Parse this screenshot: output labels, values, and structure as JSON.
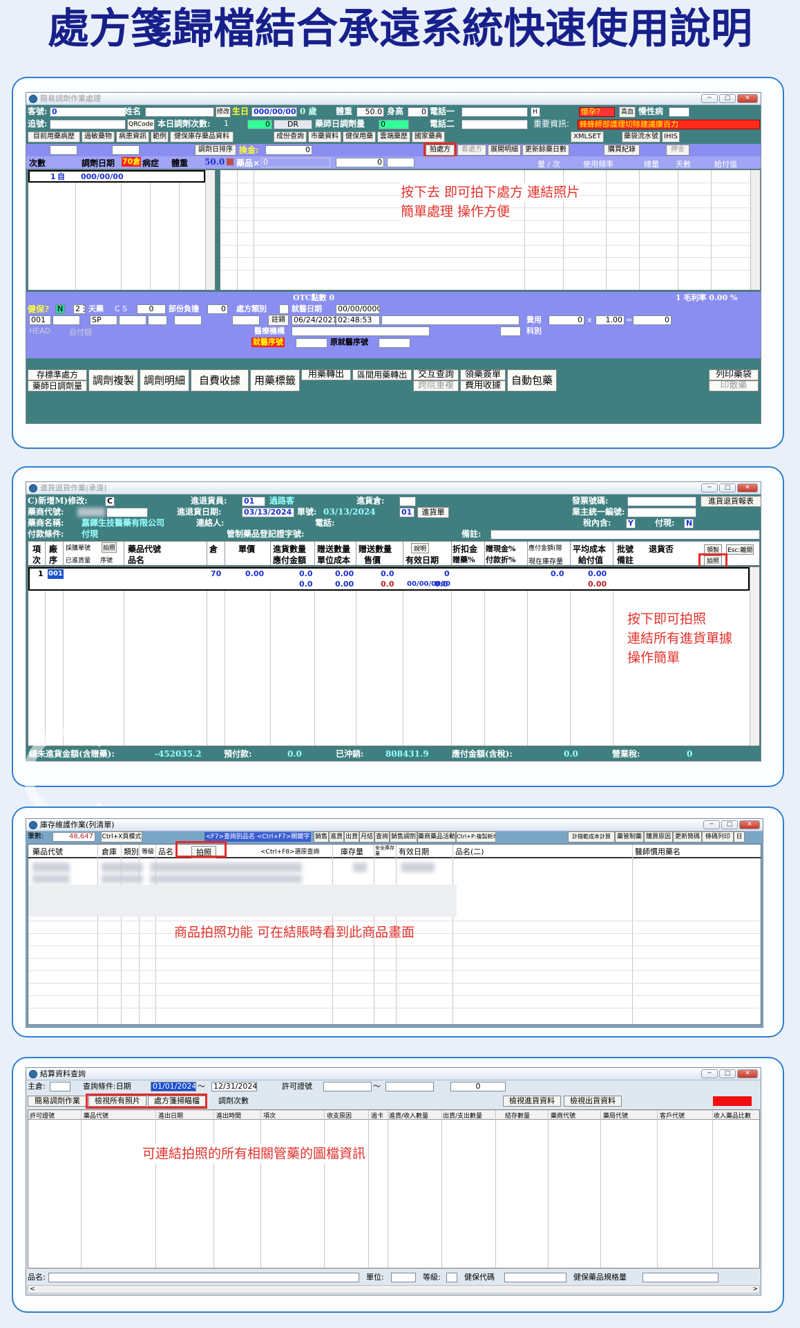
{
  "title": "處方箋歸檔結合承遠系統快速使用說明",
  "s1": {
    "win_title": "簡易調劑作業處理",
    "r1": {
      "ke_hao_lbl": "客號:",
      "ke_hao": "0",
      "xing_ming": "姓名",
      "xiu_gai": "修改",
      "sheng_ri": "生日",
      "birth": "000/00/00",
      "age": "0 歲",
      "tizhong_lbl": "體重",
      "tizhong": "50.0",
      "shengao_lbl": "身高",
      "shengao": "0",
      "dianhua1": "電話一",
      "h": "H",
      "huaiyun": "懷孕?",
      "gaoxue": "高血",
      "manxing": "慢性病"
    },
    "r2": {
      "zhui_hao": "追號:",
      "qrcode": "QRCode",
      "benri": "本日調劑次數:",
      "benri_val": "1",
      "zero": "0",
      "dr": "DR",
      "yaoshi": "藥師日調劑量",
      "yaoshi_val": "0",
      "dianhua2": "電話二",
      "zhongyao": "重要資訊:",
      "warning": "蜂蜂師部護理切除建議康百力"
    },
    "r3": {
      "b1": "目前用藥病歷",
      "b2": "過敏藥物",
      "b3": "病患資訊",
      "b4": "範例",
      "b5": "健保庫存藥品資料",
      "b6": "成份查詢",
      "b7": "市藥資料",
      "b8": "健保用藥",
      "b9": "雲端藥歷",
      "b10": "國家藥典",
      "b11": "XMLSET",
      "b12": "藥袋流水號",
      "b13": "IHIS"
    },
    "r4": {
      "paixu": "調劑日排序",
      "huanjin": "換金:",
      "huanjin_val": "0",
      "paichufang": "拍處方",
      "kanchufang": "看處方",
      "zhankai": "展開明細",
      "gengxin": "更新餘藥日數",
      "gouyao": "購買紀錄",
      "yajin": "押金"
    },
    "r5": {
      "cishu": "次數",
      "tiaoji": "調劑日期",
      "tiaoji_badge": "70倉",
      "bingzheng": "病症",
      "tizhong": "體重",
      "tz_val": "50.0",
      "yaopin": "藥品×",
      "yp_val": "0",
      "val2": "0",
      "liang": "量 / 次",
      "pinlv": "使用頻率",
      "zongliang": "總量",
      "tianshu": "天數",
      "jifu": "給付值"
    },
    "row1": {
      "n": "1",
      "zi": "自",
      "d": "000/00/00"
    },
    "note1": "按下去 即可拍下處方 連結照片",
    "note2": "簡單處理  操作方便",
    "bottom": {
      "otc": "OTC點數 0",
      "mao": "1 毛利率  0.00 %",
      "jianbao": "健保?",
      "n": "N",
      "tian": "2 天藥",
      "cs": "C S",
      "cs_val": "0",
      "fuzhan": "部份負擔",
      "fz_val": "0",
      "chufang": "處方類別",
      "jiuzhen": "就醫日期",
      "jz_val": "00/00/0000",
      "c001": "001",
      "sp": "SP",
      "zhuxiao": "註銷",
      "date": "06/24/2021",
      "time": "02:48:53",
      "feiyong": "費用",
      "fy_val": "0",
      "x": "x",
      "rate": "1.00",
      "eq": "=",
      "total": "0",
      "head": "HEAD",
      "zifu": "自付額",
      "yiliao": "醫療機構",
      "kebie": "科別",
      "jiujing": "就醫序號",
      "yuanjiu": "原就醫序號"
    },
    "bb": {
      "a1": "存標準處方",
      "a2": "藥師日調劑量",
      "b": "調劑複製",
      "c": "調劑明細",
      "d": "自費收據",
      "e": "用藥標籤",
      "f": "用藥轉出",
      "g": "區間用藥轉出",
      "h1": "交互查詢",
      "h2": "跨院重複",
      "i1": "領藥簽單",
      "i2": "費用收據",
      "j": "自動包藥",
      "k1": "列印藥袋",
      "k2": "印散藥"
    }
  },
  "s2": {
    "win_title": "進貨退貨作業(承遠)",
    "r1": {
      "xinzeng": "C)新增M)修改:",
      "c": "C",
      "jintui": "進退貨員:",
      "jt_val": "01",
      "guolu": "過路客",
      "jinhuo": "進貨倉:",
      "fapiao": "發票號碼:",
      "baobiao": "進貨退貨報表"
    },
    "r2": {
      "daihao": "藥商代號:",
      "riqi": "進退貨日期:",
      "riqi_val": "03/13/2024",
      "danhao": "單號:",
      "dh_val": "03/13/2024",
      "dh_n": "01",
      "jinhuodan": "進貨單",
      "yezhu": "業主統一編號:"
    },
    "r3": {
      "mingcheng": "藥商名稱:",
      "mc_val": "嘉鐸生技醫藥有限公司",
      "lianluo": "連絡人:",
      "dianhua": "電話:",
      "shuinei": "稅內含:",
      "y": "Y",
      "fuqing": "付現:",
      "n": "N"
    },
    "r4": {
      "tiaojian": "付款條件:",
      "tj_val": "付現",
      "guanzhi": "管制藥品登記證字號:",
      "beizhu": "備註:"
    },
    "h": {
      "xiang": "項",
      "ci": "次",
      "chang": "廠",
      "xu": "序",
      "caigou": "採購單號",
      "paizhao": "拍照",
      "yijin": "已進貨量",
      "xuhao": "序號",
      "daihao": "藥品代號",
      "pinming": "品名",
      "cang": "倉",
      "danjia": "單價",
      "jhsl": "進貨數量",
      "yingfu": "應付金額",
      "zssl": "贈送數量",
      "dwcb": "單位成本",
      "zsje": "贈送數量",
      "shoujia": "售價",
      "shuoming": "說明",
      "youxiao": "有效日期",
      "zhekou": "折扣金",
      "zengyao": "贈藥%",
      "zengxian": "贈現金%",
      "fukuan": "付款折%",
      "yingfuje": "應付金額(贈",
      "xianzai": "現在庫存量",
      "pjcb": "平均成本",
      "jifu": "給付值",
      "pihao": "批號",
      "beizhu": "備註",
      "tuihuo": "退貨否",
      "lingzhuang": "領製",
      "esc": "Esc:離開",
      "paizhao2": "拍照"
    },
    "row": {
      "n": "1",
      "code": "001",
      "cang": "70",
      "p": "0.00",
      "a": "0.0",
      "b": "0.0",
      "c": "0.00",
      "d": "0.00",
      "e": "0.0",
      "f": "0.0",
      "g": "0.0",
      "h": "0.0",
      "date": "00/00/0000",
      "i": "0",
      "j": "0.0",
      "k": "0.0",
      "l": "0.00",
      "m": "0.00"
    },
    "note1": "按下即可拍照",
    "note2": "連結所有進貨單據",
    "note3": "操作簡單",
    "foot": {
      "a": "總未進貨金額(含贈藥):",
      "a_val": "-452035.2",
      "b": "預付款:",
      "b_val": "0.0",
      "c": "已沖銷:",
      "c_val": "808431.9",
      "d": "應付金額(含稅):",
      "d_val": "0.0",
      "e": "營業稅:",
      "e_val": "0"
    }
  },
  "s3": {
    "win_title": "庫存維護作業(列清單)",
    "bishu": "筆數:",
    "bishu_val": "48,647",
    "ctrlx": "Ctrl+X頁模式",
    "f7": "<F7>查詢別品名 <Ctrl+F7>關鍵字",
    "tabs": [
      "銷售",
      "進貨",
      "出貨",
      "月結",
      "查詢",
      "銷售調劑",
      "藥商藥品活動",
      "Ctrl+P:複製新增"
    ],
    "right": [
      "計錯範成本計算",
      "藥管制藥",
      "購買原因",
      "更新簡碼",
      "條碼列印",
      "日"
    ],
    "h": {
      "daihao": "藥品代號",
      "cangku": "倉庫",
      "leibie": "類別",
      "dengji": "等級",
      "pinming": "品名",
      "paizhao": "拍照",
      "ctrlf8": "<Ctrl+F8>選原查詢",
      "kucun": "庫存量",
      "anquan": "安全庫存量",
      "youxiao": "有效日期",
      "pm2": "品名(二)",
      "yishi": "醫師慣用藥名"
    },
    "note": "商品拍照功能  可在結賬時看到此商品畫面"
  },
  "s4": {
    "win_title": "結算資料查詢",
    "zhuguan": "主倉:",
    "chaxun": "查詢條件:日期",
    "d1": "01/01/2024",
    "tilde": "～",
    "d2": "12/31/2024",
    "xuke": "許可證號",
    "tilde2": "～",
    "zero": "0",
    "b1": "簡易調劑作業",
    "b2": "檢視所有照片",
    "b3": "處方箋掃瞄檔",
    "b4": "調劑次數",
    "b5": "檢視進貨資料",
    "b6": "檢視出貨資料",
    "cols": [
      "許可證號",
      "藥品代號",
      "進出日期",
      "進出時間",
      "項次",
      "收支原因",
      "過卡",
      "進貨/收入數量",
      "出貨/支出數量",
      "結存數量",
      "藥商代號",
      "藥局代號",
      "客戶代號",
      "收入藥品比數"
    ],
    "note": "可連結拍照的所有相關管藥的圖檔資訊",
    "foot": {
      "pinming": "品名:",
      "danwei": "單位:",
      "dengji": "等級:",
      "jianbao": "健保代碼",
      "guige": "健保藥品規格量"
    }
  }
}
